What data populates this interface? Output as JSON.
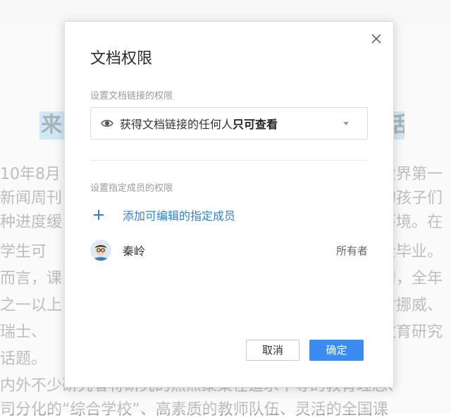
{
  "background_doc": {
    "heading_left": "来",
    "heading_right": "话",
    "lines": [
      {
        "left": "10年8月",
        "right": "世界第一"
      },
      {
        "left": "新闻周刊",
        "right": "的孩子们"
      },
      {
        "left": "种进度缓",
        "right": "环境。在"
      },
      {
        "left": "  学生可",
        "right": "士毕业。"
      },
      {
        "left": "而言，课",
        "right": "情，全年"
      },
      {
        "left": "之一以上",
        "right": "对挪威、"
      },
      {
        "left": "  瑞士、",
        "right": "教育研究"
      },
      {
        "left": "话题。",
        "right": ""
      },
      {
        "left": "内外不少研究者将研究的焦点聚集在追求平等的教育理念、",
        "right": ""
      },
      {
        "left": "司分化的“综合学校”、高素质的教师队伍、灵活的全国课",
        "right": ""
      }
    ]
  },
  "dialog": {
    "title": "文档权限",
    "link_section_label": "设置文档链接的权限",
    "link_permission": {
      "prefix": "获得文档链接的任何人",
      "emphasis": "只可查看"
    },
    "members_section_label": "设置指定成员的权限",
    "add_member_label": "添加可编辑的指定成员",
    "members": [
      {
        "name": "秦岭",
        "role": "所有者"
      }
    ],
    "cancel_label": "取消",
    "confirm_label": "确定"
  },
  "colors": {
    "accent": "#3b8cf0",
    "link": "#2f7fd8"
  }
}
